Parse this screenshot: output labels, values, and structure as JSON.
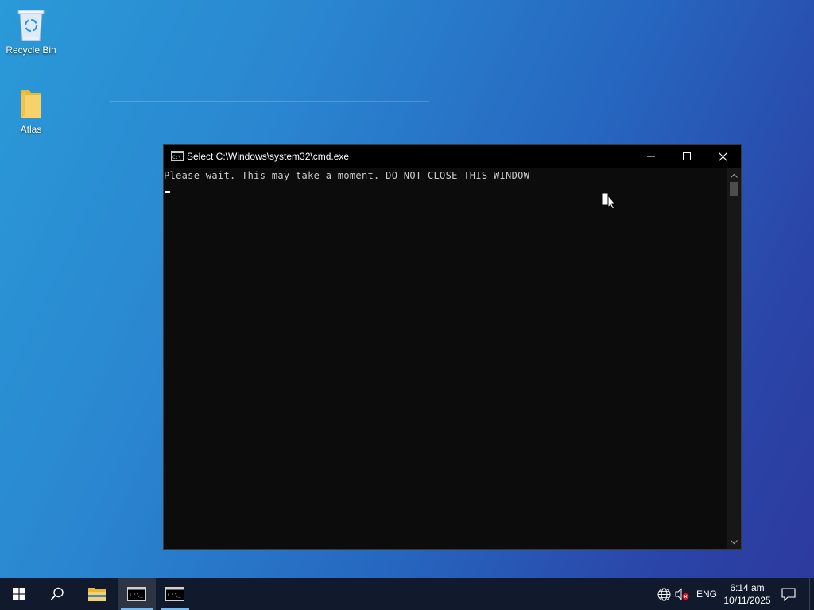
{
  "desktop": {
    "icons": [
      {
        "label": "Recycle Bin",
        "icon": "recycle-bin-icon"
      },
      {
        "label": "Atlas",
        "icon": "folder-icon"
      }
    ]
  },
  "cmd_window": {
    "title": "Select C:\\Windows\\system32\\cmd.exe",
    "output_line": "Please wait. This may take a moment. DO NOT CLOSE THIS WINDOW",
    "background_color": "#0c0c0c",
    "text_color": "#cccccc"
  },
  "taskbar": {
    "items": [
      {
        "name": "start",
        "icon": "windows-logo-icon"
      },
      {
        "name": "search",
        "icon": "search-icon"
      },
      {
        "name": "file-explorer",
        "icon": "folder-icon"
      },
      {
        "name": "cmd-1",
        "icon": "cmd-icon",
        "active": true
      },
      {
        "name": "cmd-2",
        "icon": "cmd-icon",
        "active": false
      }
    ],
    "tray": {
      "language": "ENG",
      "time": "6:14 am",
      "date": "10/11/2025"
    },
    "background_color": "#101a2c",
    "accent_color": "#76b9ed"
  }
}
